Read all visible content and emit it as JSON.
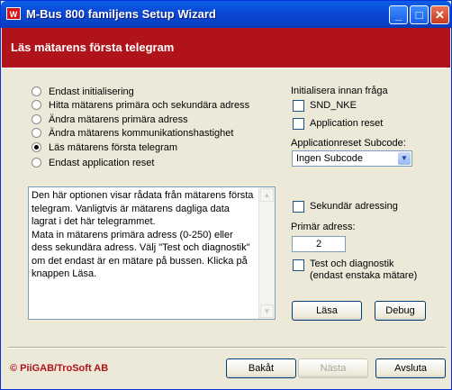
{
  "window": {
    "title": "M-Bus 800 familjens Setup Wizard",
    "app_icon_glyph": "W",
    "controls": {
      "minimize": "_",
      "maximize": "□",
      "close": "✕"
    }
  },
  "banner": {
    "title": "Läs mätarens första telegram"
  },
  "options": [
    {
      "label": "Endast initialisering",
      "selected": false
    },
    {
      "label": "Hitta mätarens primära och sekundära adress",
      "selected": false
    },
    {
      "label": "Ändra mätarens primära adress",
      "selected": false
    },
    {
      "label": "Ändra mätarens kommunikationshastighet",
      "selected": false
    },
    {
      "label": "Läs mätarens första telegram",
      "selected": true
    },
    {
      "label": "Endast application reset",
      "selected": false
    }
  ],
  "info_text": "Den här optionen visar rådata från mätarens första telegram. Vanligtvis är mätarens dagliga data lagrat i det här telegrammet.\nMata in mätarens primära adress (0-250) eller dess sekundära adress. Välj \"Test och diagnostik\" om det endast är en mätare på bussen. Klicka på knappen Läsa.",
  "init": {
    "label": "Initialisera innan fråga",
    "snd_nke": {
      "label": "SND_NKE",
      "checked": false
    },
    "app_reset": {
      "label": "Application reset",
      "checked": false
    }
  },
  "subcode": {
    "label": "Applicationreset Subcode:",
    "value": "Ingen Subcode"
  },
  "secondary": {
    "label": "Sekundär adressing",
    "checked": false
  },
  "primary": {
    "label": "Primär adress:",
    "value": "2"
  },
  "test": {
    "label_line1": "Test och diagnostik",
    "label_line2": "(endast enstaka mätare)",
    "checked": false
  },
  "buttons": {
    "read": "Läsa",
    "debug": "Debug",
    "back": "Bakåt",
    "next": "Nästa",
    "cancel": "Avsluta"
  },
  "footer": {
    "copyright": "© PiiGAB/TroSoft AB"
  },
  "colors": {
    "banner": "#b1131a",
    "titlebar": "#0b49d6",
    "face": "#ece9d8"
  }
}
